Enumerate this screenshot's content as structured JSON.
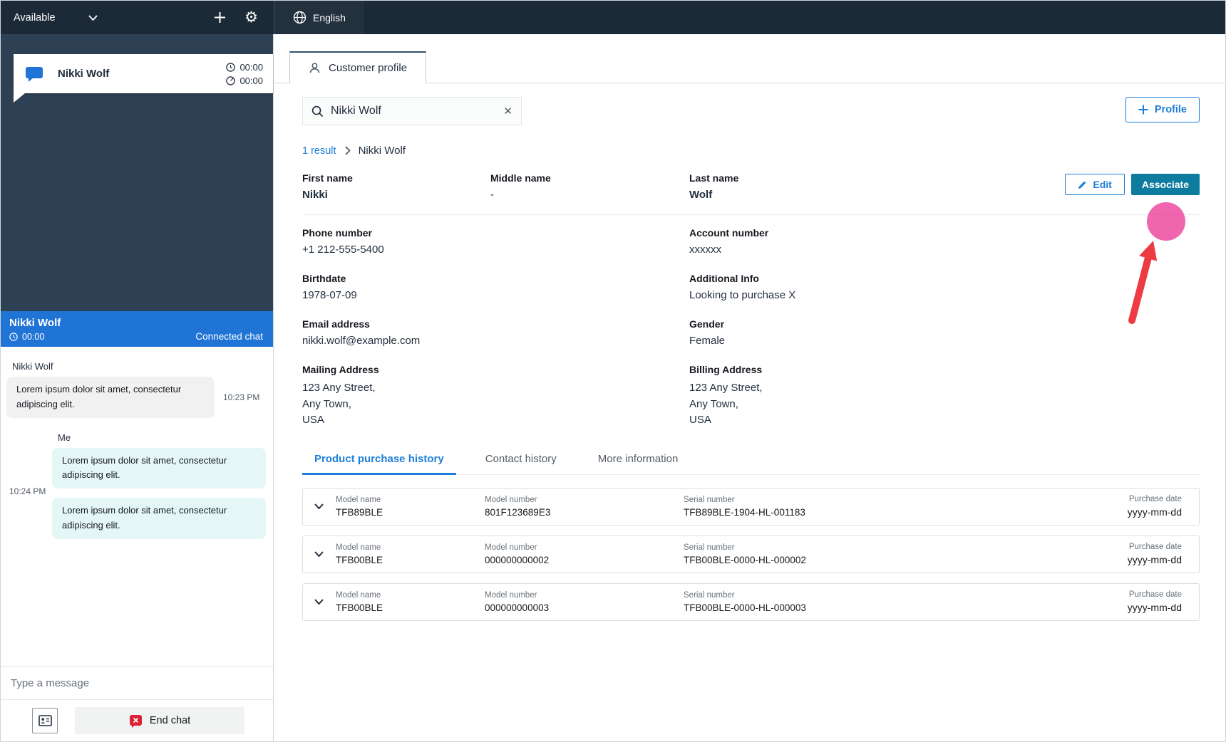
{
  "colors": {
    "topbar_bg": "#1c2a38",
    "sidebar_bg": "#2e4154",
    "accent_blue": "#1d7fd9",
    "chat_header_blue": "#2074d5",
    "associate_bg": "#0e7c9f",
    "bubble_customer": "#f1f1f1",
    "bubble_agent": "#e4f6f6",
    "annotation_pink": "#e5067d",
    "annotation_red": "#ee3b43",
    "end_chat_red": "#da2332"
  },
  "topbar": {
    "status": "Available",
    "language": "English"
  },
  "sidebar": {
    "chat_card": {
      "name": "Nikki Wolf",
      "timer1": "00:00",
      "timer2": "00:00"
    },
    "chat": {
      "header_name": "Nikki Wolf",
      "header_timer": "00:00",
      "header_status": "Connected chat",
      "customer_name": "Nikki Wolf",
      "customer_message": "Lorem ipsum dolor sit amet, consectetur adipiscing elit.",
      "customer_time": "10:23 PM",
      "me_label": "Me",
      "agent_time": "10:24 PM",
      "agent_messages": [
        "Lorem ipsum dolor sit amet, consectetur adipiscing elit.",
        "Lorem ipsum dolor sit amet, consectetur adipiscing elit."
      ],
      "input_placeholder": "Type a message",
      "end_chat_label": "End chat"
    }
  },
  "main": {
    "tab_label": "Customer profile",
    "search_value": "Nikki Wolf",
    "profile_button_label": "Profile",
    "breadcrumb": {
      "results": "1 result",
      "name": "Nikki Wolf"
    },
    "actions": {
      "edit": "Edit",
      "associate": "Associate"
    },
    "profile": {
      "first_name_label": "First name",
      "first_name": "Nikki",
      "middle_name_label": "Middle name",
      "middle_name": "-",
      "last_name_label": "Last name",
      "last_name": "Wolf",
      "phone_label": "Phone number",
      "phone": "+1 212-555-5400",
      "account_label": "Account number",
      "account": "xxxxxx",
      "birthdate_label": "Birthdate",
      "birthdate": "1978-07-09",
      "additional_label": "Additional Info",
      "additional": "Looking to purchase X",
      "email_label": "Email address",
      "email": "nikki.wolf@example.com",
      "gender_label": "Gender",
      "gender": "Female",
      "mailing_label": "Mailing Address",
      "mailing_lines": [
        "123 Any Street,",
        "Any Town,",
        "USA"
      ],
      "billing_label": "Billing Address",
      "billing_lines": [
        "123 Any Street,",
        "Any Town,",
        "USA"
      ]
    },
    "history_tabs": [
      "Product purchase history",
      "Contact history",
      "More information"
    ],
    "purchase_labels": {
      "model_name": "Model name",
      "model_number": "Model number",
      "serial_number": "Serial number",
      "purchase_date": "Purchase date"
    },
    "purchases": [
      {
        "model_name": "TFB89BLE",
        "model_number": "801F123689E3",
        "serial_number": "TFB89BLE-1904-HL-001183",
        "purchase_date": "yyyy-mm-dd"
      },
      {
        "model_name": "TFB00BLE",
        "model_number": "000000000002",
        "serial_number": "TFB00BLE-0000-HL-000002",
        "purchase_date": "yyyy-mm-dd"
      },
      {
        "model_name": "TFB00BLE",
        "model_number": "000000000003",
        "serial_number": "TFB00BLE-0000-HL-000003",
        "purchase_date": "yyyy-mm-dd"
      }
    ]
  }
}
